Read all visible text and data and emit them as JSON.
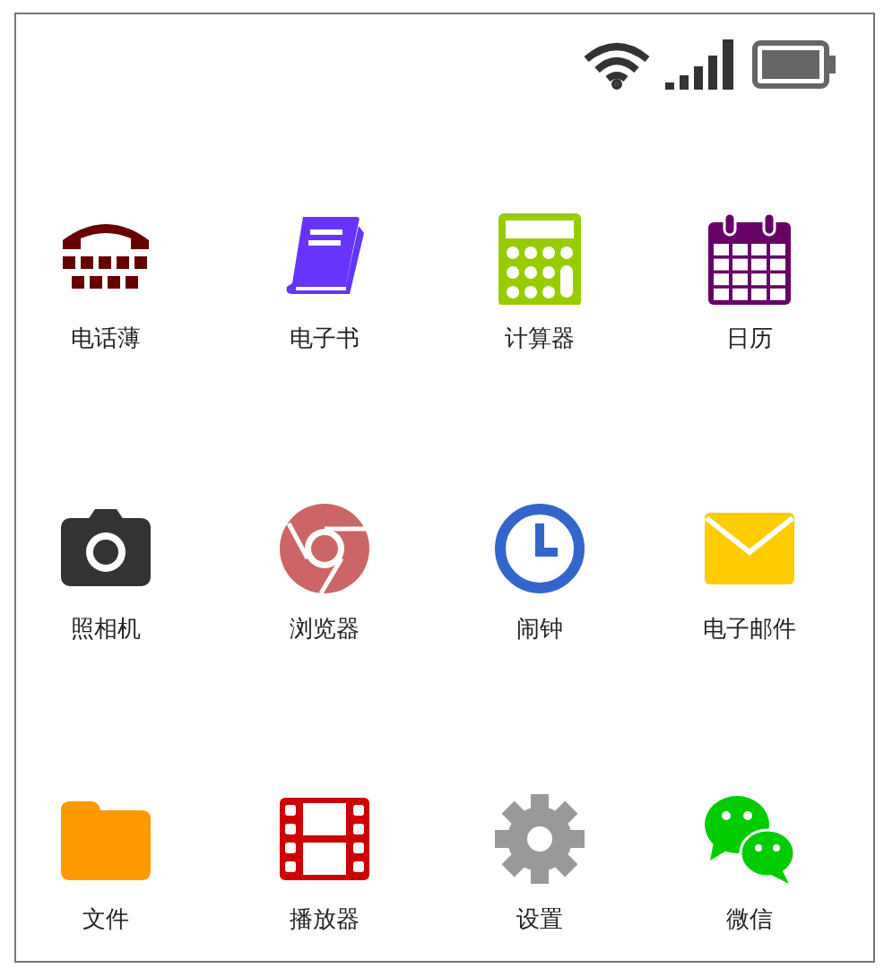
{
  "apps": [
    {
      "label": "电话薄",
      "kind": "phone"
    },
    {
      "label": "电子书",
      "kind": "book"
    },
    {
      "label": "计算器",
      "kind": "calculator"
    },
    {
      "label": "日历",
      "kind": "calendar"
    },
    {
      "label": "照相机",
      "kind": "camera"
    },
    {
      "label": "浏览器",
      "kind": "browser"
    },
    {
      "label": "闹钟",
      "kind": "clock"
    },
    {
      "label": "电子邮件",
      "kind": "mail"
    },
    {
      "label": "文件",
      "kind": "folder"
    },
    {
      "label": "播放器",
      "kind": "film"
    },
    {
      "label": "设置",
      "kind": "gear"
    },
    {
      "label": "微信",
      "kind": "chat"
    }
  ]
}
